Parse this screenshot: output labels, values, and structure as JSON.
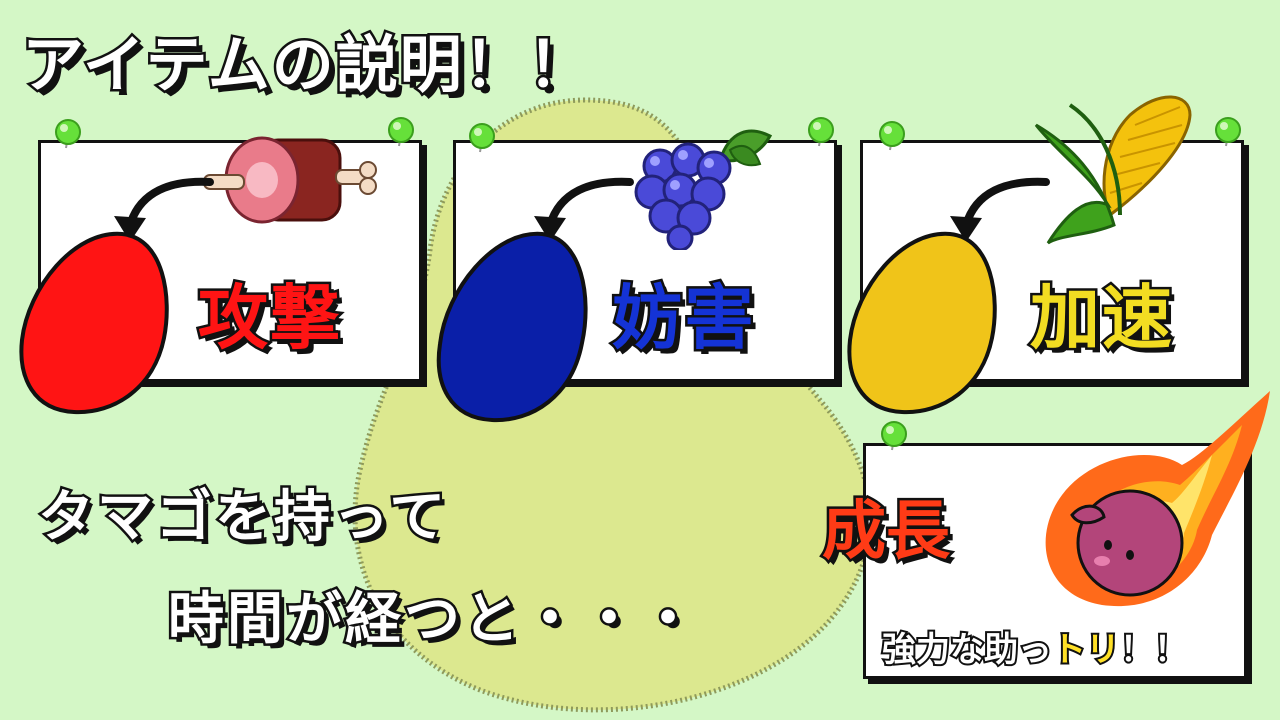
{
  "title": "アイテムの説明！！",
  "colors": {
    "background": "#d4f7c6",
    "blob": "#dce88f",
    "attack": "#ff1414",
    "obstruct": "#1433d6",
    "speed": "#f2cc22",
    "growth": "#ff3b16",
    "pin": "#66e03a"
  },
  "items": [
    {
      "item_icon": "meat-icon",
      "label": "攻撃",
      "egg_color": "#ff1414"
    },
    {
      "item_icon": "grapes-icon",
      "label": "妨害",
      "egg_color": "#0a1fa8"
    },
    {
      "item_icon": "corn-icon",
      "label": "加速",
      "egg_color": "#f0c419"
    }
  ],
  "caption": {
    "line1": "タマゴを持って",
    "line2": "時間が経つと・・・"
  },
  "growth": {
    "title": "成長",
    "subtitle_prefix": "強力な助っ",
    "subtitle_highlight": "トリ",
    "subtitle_suffix": "！！",
    "icon": "fireball-bird-icon"
  }
}
